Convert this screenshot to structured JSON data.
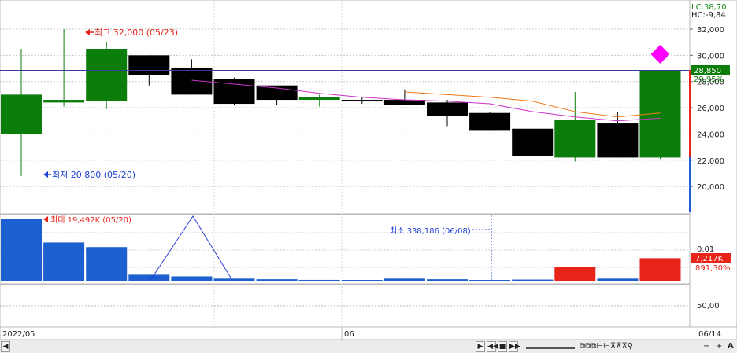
{
  "price_panel": {
    "high_label": "최고 32,000 (05/23)",
    "low_label": "최저 20,800 (05/20)",
    "lc_label": "LC:38,70",
    "hc_label": "HC:-9,84",
    "current_price": "28,850",
    "current_pct": "29,95%",
    "y_ticks": [
      "32,000",
      "30,000",
      "28,000",
      "26,000",
      "24,000",
      "22,000",
      "20,000"
    ]
  },
  "volume_panel": {
    "max_label": "최대 19,492K (05/20)",
    "min_label": "최소 338,186 (06/08)",
    "axis_tick": "0,01",
    "current_volume": "7,217K",
    "current_pct": "891,30%"
  },
  "bottom_panel": {
    "axis_tick": "50,00"
  },
  "date_axis": {
    "start": "2022/05",
    "mid": "06",
    "end": "06/14"
  },
  "colors": {
    "up": "#0b7d0b",
    "down": "#000000",
    "vol_up": "#e8231a",
    "vol_down": "#1c5fd0",
    "ma_short": "#cc33cc",
    "ma_long": "#f07a1a",
    "marker": "#ff00ff",
    "current_line": "#3a3a9a"
  },
  "chart_data": {
    "type": "candlestick",
    "x": [
      "05/20",
      "05/23",
      "05/24",
      "05/25",
      "05/26",
      "05/27",
      "05/30",
      "05/31",
      "06/02",
      "06/03",
      "06/07",
      "06/08",
      "06/09",
      "06/10",
      "06/13",
      "06/14"
    ],
    "open": [
      24000,
      26400,
      26500,
      30000,
      29000,
      28200,
      27700,
      26600,
      26600,
      26600,
      26400,
      25600,
      24400,
      22200,
      24800,
      22200
    ],
    "high": [
      30500,
      32000,
      31000,
      30000,
      29700,
      28300,
      27400,
      27000,
      26800,
      27400,
      26600,
      25700,
      24300,
      27200,
      25700,
      28850
    ],
    "low": [
      20800,
      26100,
      25900,
      27700,
      27000,
      26200,
      26200,
      26100,
      26300,
      26200,
      24600,
      24300,
      22400,
      21900,
      22200,
      22100
    ],
    "close": [
      27000,
      26600,
      30500,
      28500,
      27000,
      26300,
      26600,
      26800,
      26500,
      26200,
      25400,
      24300,
      22300,
      25100,
      22200,
      28850
    ],
    "volume": [
      19492,
      12092,
      10680,
      2100,
      1600,
      900,
      700,
      500,
      400,
      900,
      700,
      338.186,
      600,
      4500,
      900,
      7217
    ],
    "ma_short": {
      "from": "05/26",
      "values": [
        28100,
        27800,
        27500,
        27100,
        26800,
        26600,
        26500,
        26300,
        25700,
        25300,
        25000,
        25200
      ]
    },
    "ma_long": {
      "from": "06/03",
      "values": [
        27200,
        27000,
        26800,
        26500,
        25700,
        25300,
        25600
      ]
    },
    "ylim": [
      18000,
      33500
    ],
    "vol_ylim": [
      0,
      20000
    ]
  }
}
